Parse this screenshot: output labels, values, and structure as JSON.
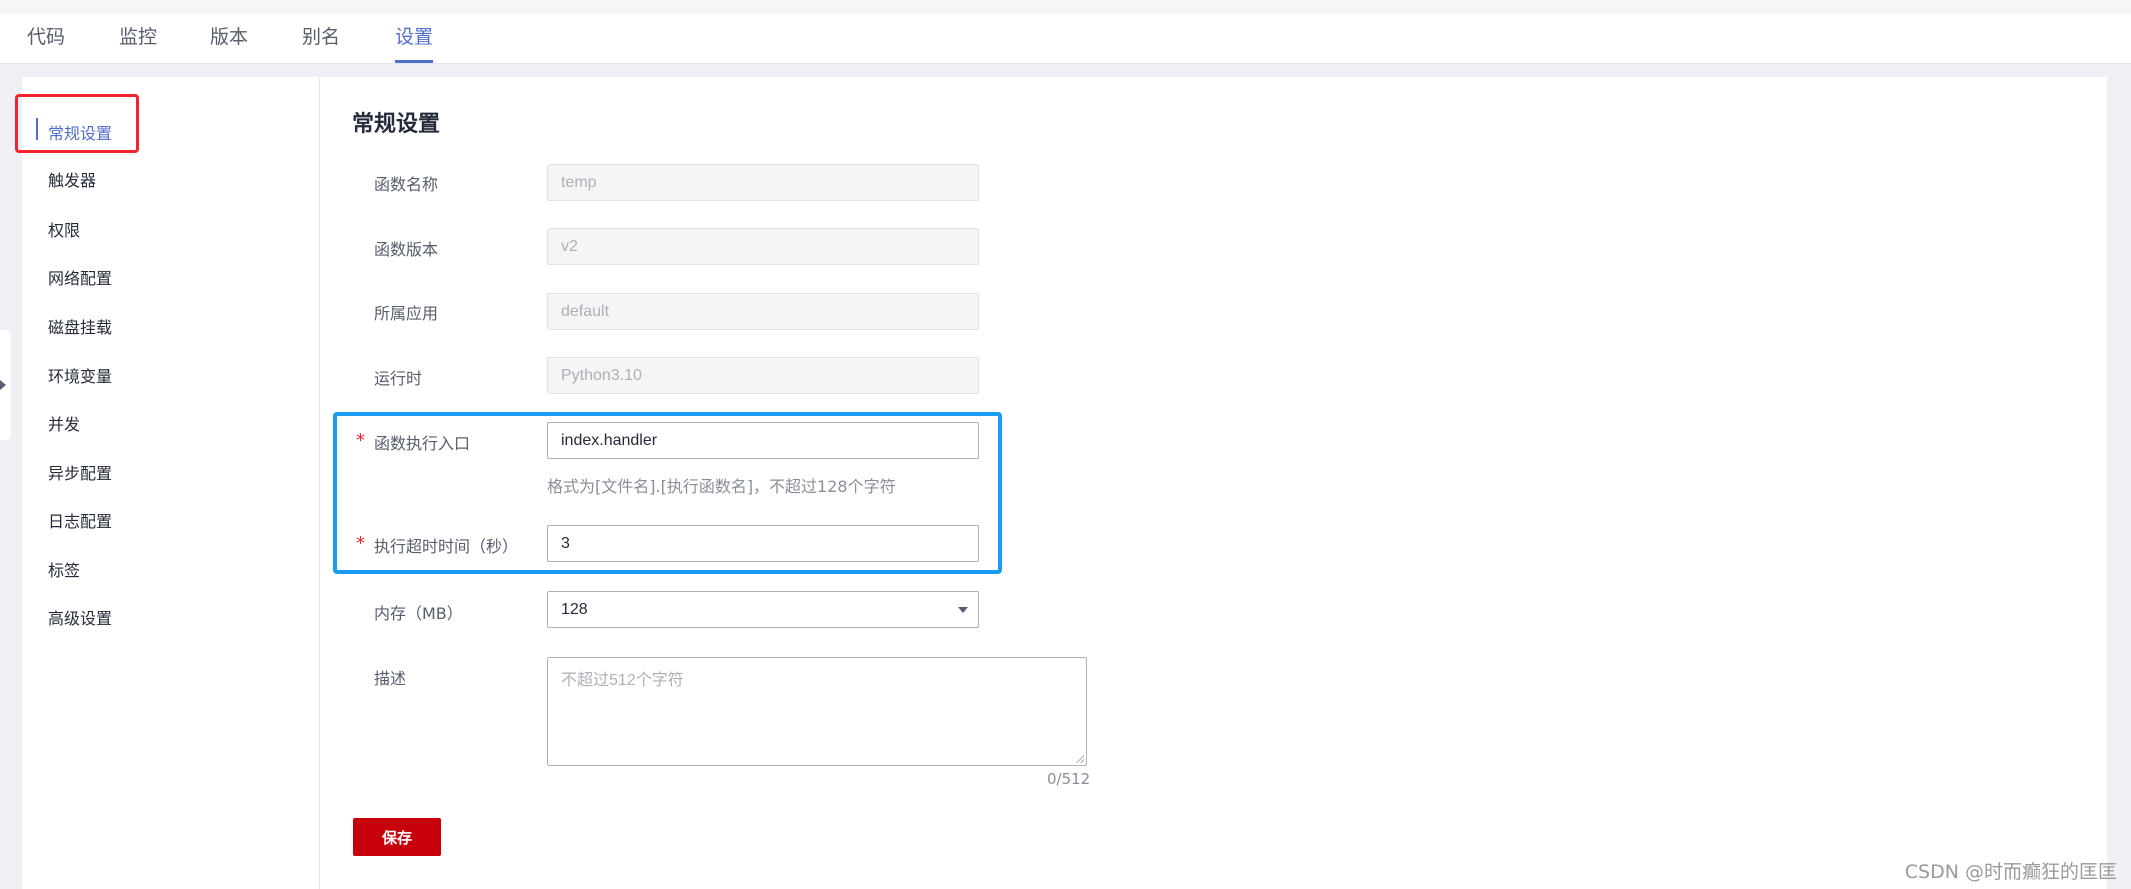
{
  "tabs": [
    {
      "label": "代码"
    },
    {
      "label": "监控"
    },
    {
      "label": "版本"
    },
    {
      "label": "别名"
    },
    {
      "label": "设置"
    }
  ],
  "sidebar": {
    "items": [
      {
        "label": "常规设置"
      },
      {
        "label": "触发器"
      },
      {
        "label": "权限"
      },
      {
        "label": "网络配置"
      },
      {
        "label": "磁盘挂载"
      },
      {
        "label": "环境变量"
      },
      {
        "label": "并发"
      },
      {
        "label": "异步配置"
      },
      {
        "label": "日志配置"
      },
      {
        "label": "标签"
      },
      {
        "label": "高级设置"
      }
    ],
    "active": "常规设置"
  },
  "form": {
    "title": "常规设置",
    "function_name": {
      "label": "函数名称",
      "value": "temp"
    },
    "function_version": {
      "label": "函数版本",
      "value": "v2"
    },
    "application": {
      "label": "所属应用",
      "value": "default"
    },
    "runtime": {
      "label": "运行时",
      "value": "Python3.10"
    },
    "handler": {
      "required_mark": "*",
      "label": "函数执行入口",
      "value": "index.handler",
      "hint": "格式为[文件名].[执行函数名]，不超过128个字符"
    },
    "timeout": {
      "required_mark": "*",
      "label": "执行超时时间（秒）",
      "value": "3"
    },
    "memory": {
      "label": "内存（MB）",
      "value": "128"
    },
    "description": {
      "label": "描述",
      "placeholder": "不超过512个字符",
      "counter": "0/512"
    },
    "save_label": "保存"
  },
  "watermark": "CSDN @时而癫狂的匡匡",
  "colors": {
    "accent": "#526ecc",
    "save_button": "#c7000b",
    "red_highlight": "#f5232d",
    "blue_highlight": "#1a9cf0"
  }
}
